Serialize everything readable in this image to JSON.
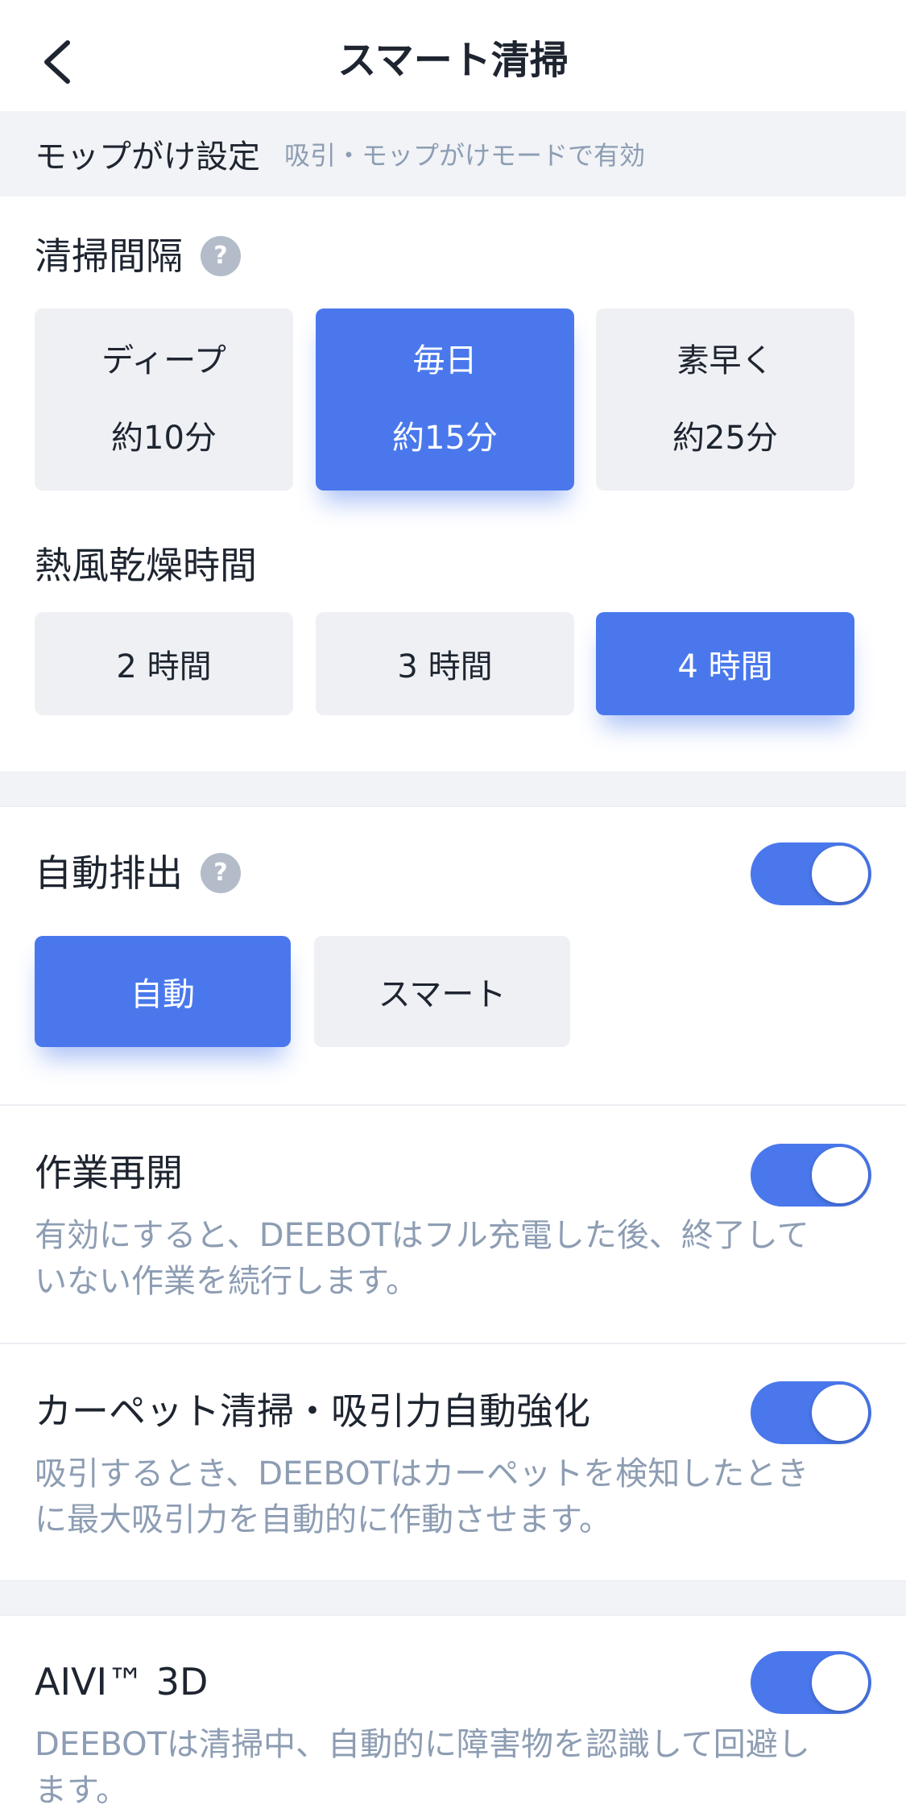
{
  "header": {
    "title": "スマート清掃"
  },
  "mop_header": {
    "label": "モップがけ設定",
    "hint": "吸引・モップがけモードで有効"
  },
  "cleaning_interval": {
    "title": "清掃間隔",
    "help": "?",
    "options": [
      {
        "name": "ディープ",
        "time": "約10分",
        "selected": false
      },
      {
        "name": "毎日",
        "time": "約15分",
        "selected": true
      },
      {
        "name": "素早く",
        "time": "約25分",
        "selected": false
      }
    ]
  },
  "hot_air_drying": {
    "title": "熱風乾燥時間",
    "options": [
      {
        "label": "2 時間",
        "selected": false
      },
      {
        "label": "3 時間",
        "selected": false
      },
      {
        "label": "4 時間",
        "selected": true
      }
    ]
  },
  "auto_empty": {
    "title": "自動排出",
    "help": "?",
    "enabled": true,
    "options": [
      {
        "label": "自動",
        "selected": true
      },
      {
        "label": "スマート",
        "selected": false
      }
    ]
  },
  "resume_work": {
    "title": "作業再開",
    "enabled": true,
    "desc_line1": "有効にすると、DEEBOTはフル充電した後、終了して",
    "desc_line2": "いない作業を続行します。"
  },
  "carpet_boost": {
    "title": "カーペット清掃・吸引力自動強化",
    "enabled": true,
    "desc_line1": "吸引するとき、DEEBOTはカーペットを検知したとき",
    "desc_line2": "に最大吸引力を自動的に作動させます。"
  },
  "aivi_3d": {
    "title": "AIVI™ 3D",
    "enabled": true,
    "desc_line1": "DEEBOTは清掃中、自動的に障害物を認識して回避し",
    "desc_line2": "ます。"
  },
  "colors": {
    "accent": "#4a78ec",
    "option_bg": "#eef0f4",
    "muted_text": "#8d9db3",
    "band_bg": "#f1f3f6"
  },
  "icons": {
    "back": "chevron-left-icon",
    "help": "question-circle-icon"
  }
}
